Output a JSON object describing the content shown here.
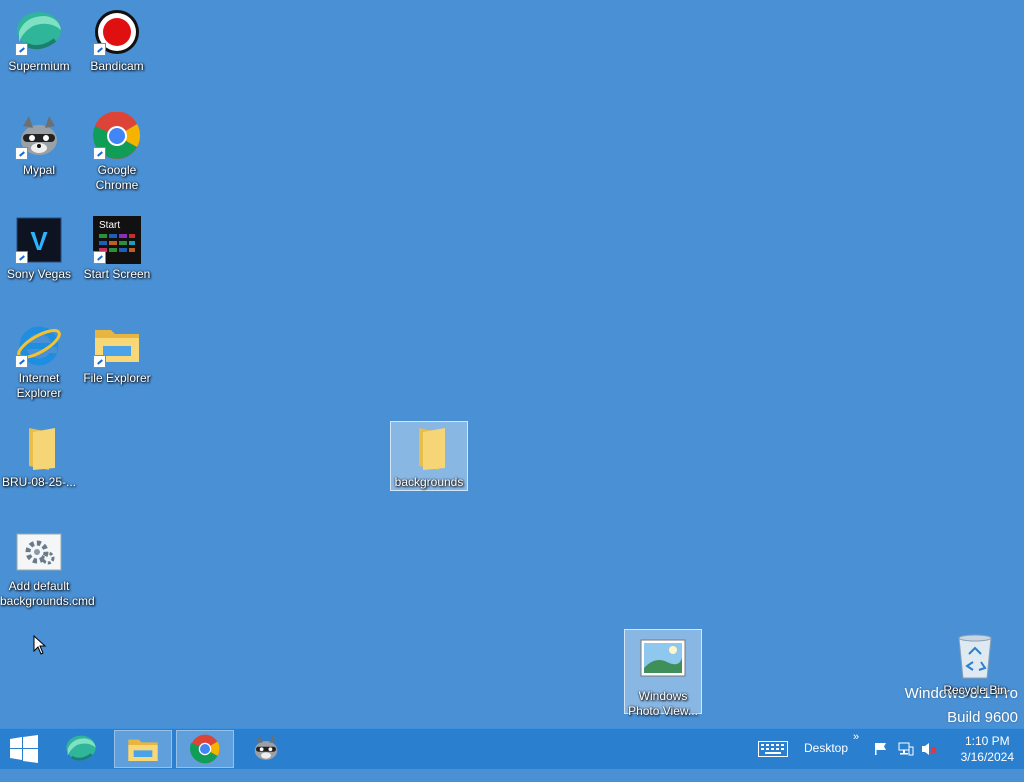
{
  "desktop": {
    "icons": [
      {
        "label": "Supermium",
        "icon": "supermium-icon"
      },
      {
        "label": "Bandicam",
        "icon": "bandicam-icon"
      },
      {
        "label": "Mypal",
        "icon": "mypal-icon"
      },
      {
        "label": "Google Chrome",
        "icon": "chrome-icon"
      },
      {
        "label": "Sony Vegas",
        "icon": "vegas-icon"
      },
      {
        "label": "Start Screen",
        "icon": "start-screen-icon",
        "inner_text": "Start"
      },
      {
        "label": "Internet Explorer",
        "icon": "internet-explorer-icon"
      },
      {
        "label": "File Explorer",
        "icon": "file-explorer-icon"
      },
      {
        "label": "BRU-08-25-...",
        "icon": "folder-icon"
      },
      {
        "label": "Add default backgrounds.cmd",
        "icon": "cmd-script-icon"
      },
      {
        "label": "backgrounds",
        "icon": "folder-icon",
        "selected": true
      },
      {
        "label": "Windows Photo View...",
        "icon": "photo-viewer-icon",
        "selected": true
      },
      {
        "label": "Recycle Bin",
        "icon": "recycle-bin-icon"
      }
    ],
    "watermark": {
      "line1": "Windows 8.1 Pro",
      "line2": "Build 9600"
    }
  },
  "taskbar": {
    "start": "start-button-icon",
    "pinned": [
      "supermium-icon",
      "file-explorer-icon",
      "chrome-icon",
      "mypal-icon"
    ],
    "desktop_toolbar": "Desktop",
    "chevron": "»",
    "clock": {
      "time": "1:10 PM",
      "date": "3/16/2024"
    }
  },
  "colors": {
    "desktop": "#4a90d4",
    "taskbar": "#2a7fcf"
  }
}
